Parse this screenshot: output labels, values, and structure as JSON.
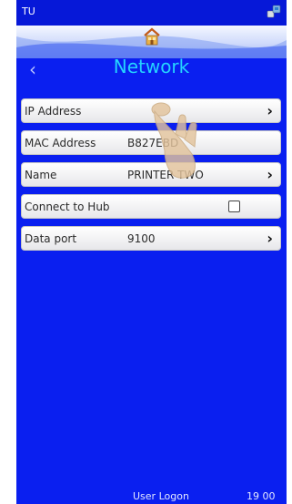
{
  "statusbar": {
    "left_text": "TU"
  },
  "screen": {
    "title": "Network"
  },
  "rows": [
    {
      "label": "IP Address",
      "value": ""
    },
    {
      "label": "MAC Address",
      "value": "B827EBD"
    },
    {
      "label": "Name",
      "value": "PRINTER TWO"
    },
    {
      "label": "Connect to Hub",
      "value": ""
    },
    {
      "label": "Data port",
      "value": "9100"
    }
  ],
  "footer": {
    "user": "User Logon",
    "time": "19 00"
  },
  "colors": {
    "background": "#0a1ff0",
    "title": "#24d3ff",
    "row_bg": "#f2f2f4"
  },
  "icons": {
    "status": "network-status-icon",
    "home": "home-icon",
    "back": "chevron-left-icon",
    "chevron": "chevron-right-icon",
    "pointer": "hand-pointer-icon"
  }
}
